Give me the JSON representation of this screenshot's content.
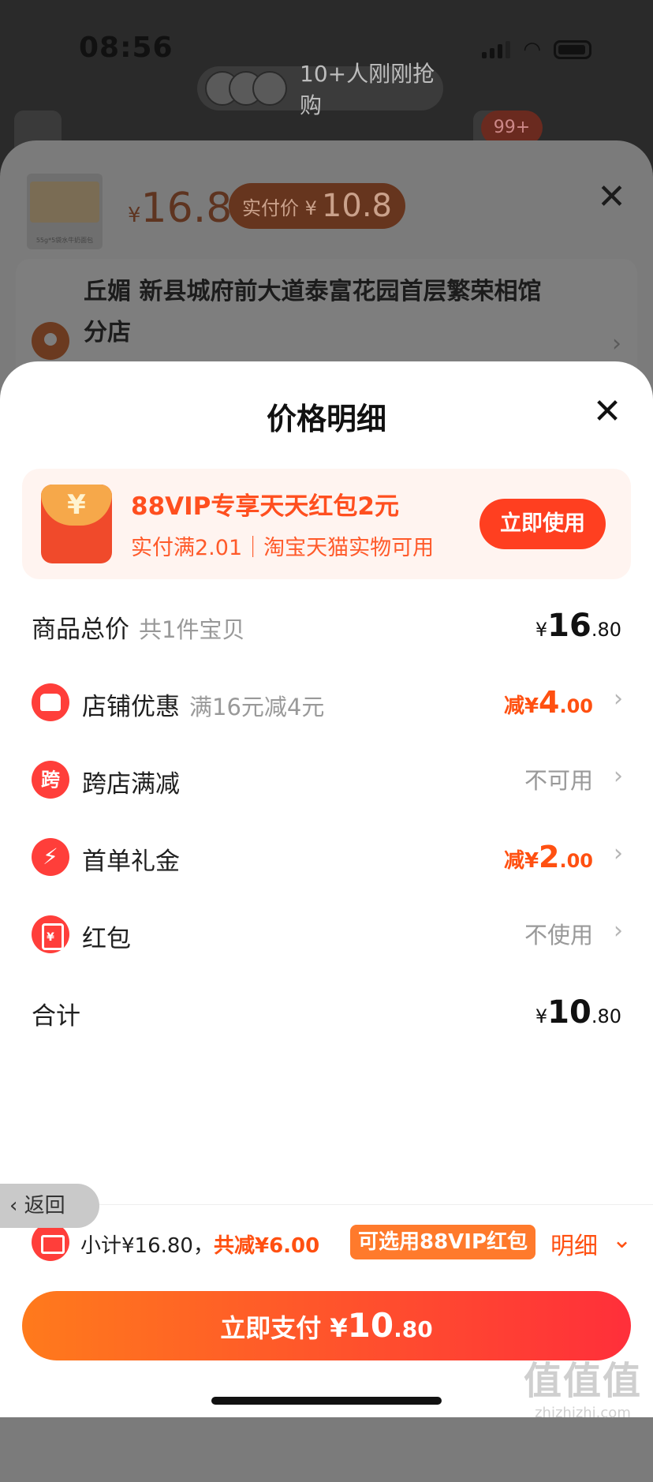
{
  "status": {
    "time": "08:56"
  },
  "background": {
    "buyers_text": "10+人刚刚抢购",
    "cart_badge": "99+"
  },
  "product_sheet": {
    "currency": "¥",
    "price": "16.8",
    "real_price_label": "实付价 ¥",
    "real_price": "10.8",
    "thumb_caption": "55g*5袋水牛奶面包",
    "address": "丘媚 新县城府前大道泰富花园首层繁荣相馆分店"
  },
  "price_detail": {
    "title": "价格明细",
    "vip_banner": {
      "icon_glyph": "¥",
      "title": "88VIP专享天天红包2元",
      "subtitle": "实付满2.01｜淘宝天猫实物可用",
      "button": "立即使用"
    },
    "rows": [
      {
        "label": "商品总价",
        "sub": "共1件宝贝",
        "currency": "¥",
        "int": "16",
        "dec": ".80"
      },
      {
        "icon": "",
        "label": "店铺优惠",
        "sub": "满16元减4元",
        "prefix": "减¥",
        "int": "4",
        "dec": ".00"
      },
      {
        "icon": "跨",
        "label": "跨店满减",
        "value": "不可用"
      },
      {
        "icon": "⚡",
        "label": "首单礼金",
        "prefix": "减¥",
        "int": "2",
        "dec": ".00"
      },
      {
        "icon": "¥",
        "label": "红包",
        "value": "不使用"
      },
      {
        "label": "合计",
        "currency": "¥",
        "int": "10",
        "dec": ".80"
      }
    ],
    "back": "返回",
    "subtotal": {
      "text": "小计¥16.80，",
      "reduce": "共减¥6.00"
    },
    "vip_tag": "可选用88VIP红包",
    "detail_link": "明细",
    "pay": {
      "label": "立即支付 ¥",
      "int": "10",
      "dec": ".80"
    }
  },
  "watermark": {
    "line1": "值值值",
    "line2": "zhizhizhi.com"
  },
  "colors": {
    "accent": "#ff5011",
    "red": "#ff3e3a"
  }
}
